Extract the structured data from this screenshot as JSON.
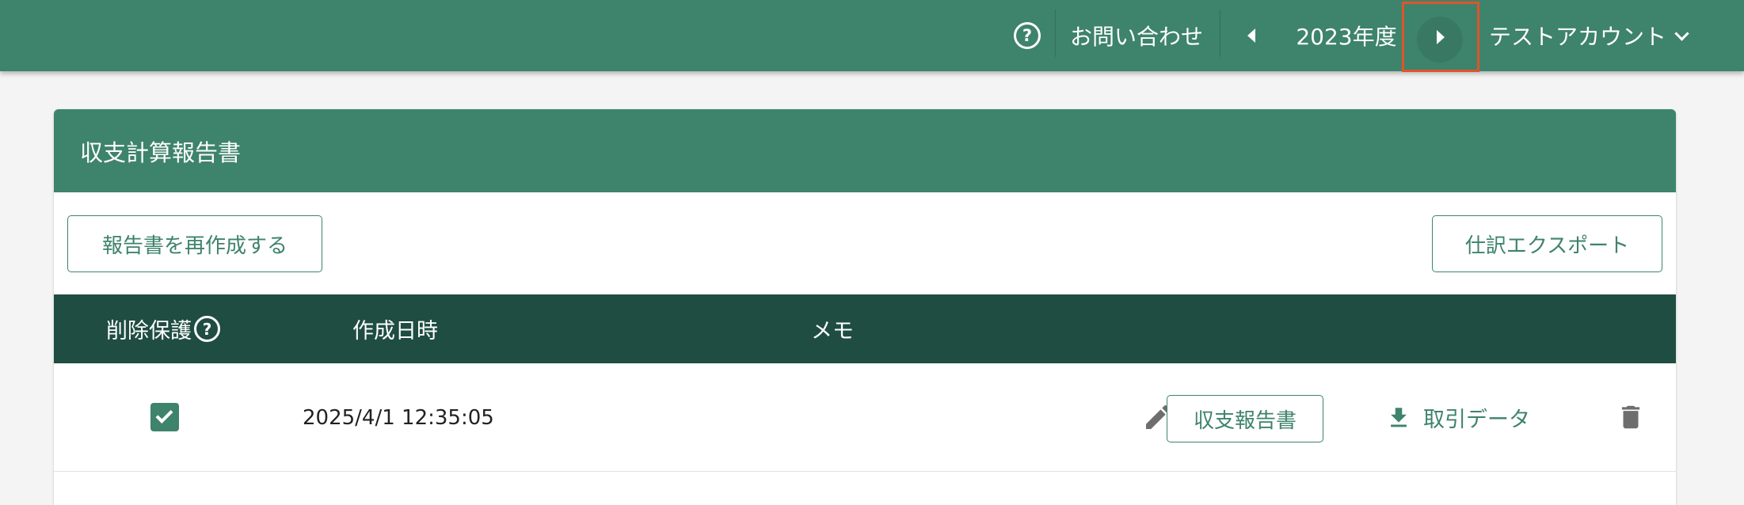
{
  "header": {
    "help_icon": "help-circle-icon",
    "help_glyph": "?",
    "contact_label": "お問い合わせ",
    "prev_year_icon": "triangle-left-icon",
    "year_label": "2023年度",
    "next_year_icon": "triangle-right-icon",
    "account_label": "テストアカウント",
    "account_dropdown_icon": "chevron-down-icon"
  },
  "card": {
    "title": "収支計算報告書",
    "recreate_button": "報告書を再作成する",
    "export_button": "仕訳エクスポート"
  },
  "table": {
    "columns": {
      "protect": "削除保護",
      "protect_help_glyph": "?",
      "created_at": "作成日時",
      "memo": "メモ"
    },
    "rows": [
      {
        "protected": true,
        "created_at": "2025/4/1 12:35:05",
        "memo": "",
        "report_button": "収支報告書",
        "data_link": "取引データ"
      }
    ]
  },
  "icons": {
    "edit": "pencil-icon",
    "download": "download-icon",
    "delete": "trash-icon"
  },
  "colors": {
    "header_green": "#3e836b",
    "table_head_dark_green": "#1f4d41",
    "highlight_red": "#e0542a",
    "background": "#f4f4f4"
  }
}
